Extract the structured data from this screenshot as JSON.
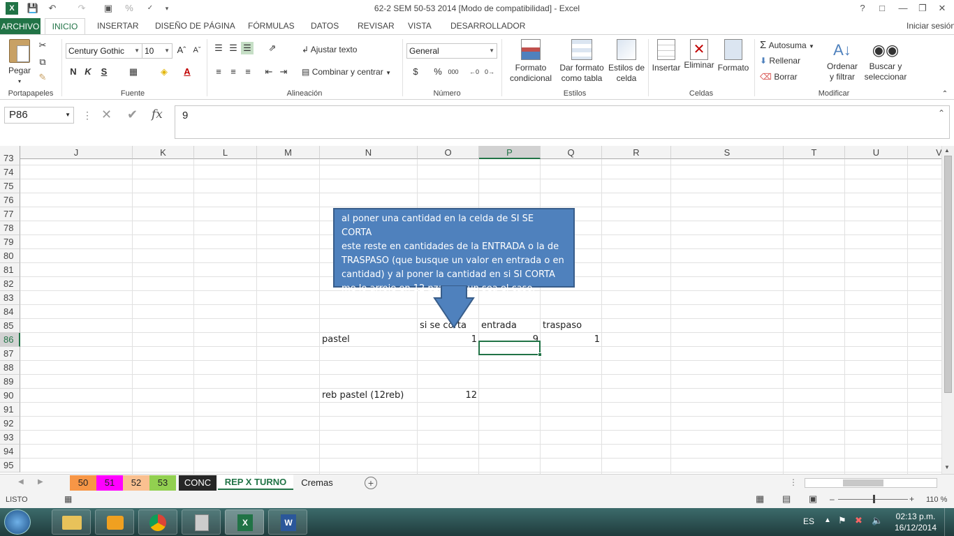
{
  "window": {
    "title": "62-2  SEM 50-53 2014  [Modo de compatibilidad] - Excel",
    "help": "?",
    "signin": "Iniciar sesión"
  },
  "tabs": [
    "ARCHIVO",
    "INICIO",
    "INSERTAR",
    "DISEÑO DE PÁGINA",
    "FÓRMULAS",
    "DATOS",
    "REVISAR",
    "VISTA",
    "DESARROLLADOR"
  ],
  "ribbon": {
    "clipboard": {
      "paste": "Pegar",
      "label": "Portapapeles"
    },
    "font": {
      "name": "Century Gothic",
      "size": "10",
      "bold": "N",
      "italic": "K",
      "underline": "S",
      "label": "Fuente"
    },
    "alignment": {
      "wrap": "Ajustar texto",
      "merge": "Combinar y centrar",
      "label": "Alineación"
    },
    "number": {
      "format": "General",
      "currency": "$",
      "percent": "%",
      "thousands": "000",
      "label": "Número"
    },
    "styles": {
      "conditional": [
        "Formato",
        "condicional"
      ],
      "table": [
        "Dar formato",
        "como tabla"
      ],
      "cell": [
        "Estilos de",
        "celda"
      ],
      "label": "Estilos"
    },
    "cells": {
      "insert": "Insertar",
      "delete": "Eliminar",
      "format": "Formato",
      "label": "Celdas"
    },
    "editing": {
      "autosum": "Autosuma",
      "fill": "Rellenar",
      "clear": "Borrar",
      "sort": [
        "Ordenar",
        "y filtrar"
      ],
      "find": [
        "Buscar y",
        "seleccionar"
      ],
      "label": "Modificar"
    }
  },
  "formula_bar": {
    "name_box": "P86",
    "fx": "fx",
    "value": "9"
  },
  "columns": [
    "J",
    "K",
    "L",
    "M",
    "N",
    "O",
    "P",
    "Q",
    "R",
    "S",
    "T",
    "U",
    "V"
  ],
  "rows": [
    "73",
    "74",
    "75",
    "76",
    "77",
    "78",
    "79",
    "80",
    "81",
    "82",
    "83",
    "84",
    "85",
    "86",
    "87",
    "88",
    "89",
    "90",
    "91",
    "92",
    "93",
    "94",
    "95"
  ],
  "cells": {
    "O85": "si se corta",
    "P85": "entrada",
    "Q85": "traspaso",
    "N86": "pastel",
    "O86": "1",
    "P86": "9",
    "Q86": "1",
    "N90": "reb pastel (12reb)",
    "O90": "12"
  },
  "callout": {
    "lines": [
      "al poner una cantidad en la celda de SI SE CORTA",
      "este reste en cantidades de la ENTRADA o la de",
      "TRASPASO (que busque un valor en entrada o en",
      "cantidad) y al poner la cantidad en si SI CORTA",
      "me lo arroje en 12 pzas segun sea el caso."
    ]
  },
  "sheets": [
    {
      "name": "50",
      "color": "#f79646"
    },
    {
      "name": "51",
      "color": "#ff00ff"
    },
    {
      "name": "52",
      "color": "#fac090"
    },
    {
      "name": "53",
      "color": "#92d050"
    },
    {
      "name": "CONC",
      "color": "#262626"
    },
    {
      "name": "REP X TURNO",
      "color": "#ffffff"
    },
    {
      "name": "Cremas",
      "color": "#f3f3f3"
    }
  ],
  "status": {
    "mode": "LISTO",
    "zoom": "110 %"
  },
  "taskbar": {
    "lang": "ES",
    "time": "02:13 p.m.",
    "date": "16/12/2014"
  },
  "colors": {
    "accent": "#217346",
    "callout_fill": "#4f81bd",
    "callout_border": "#385d8a"
  }
}
